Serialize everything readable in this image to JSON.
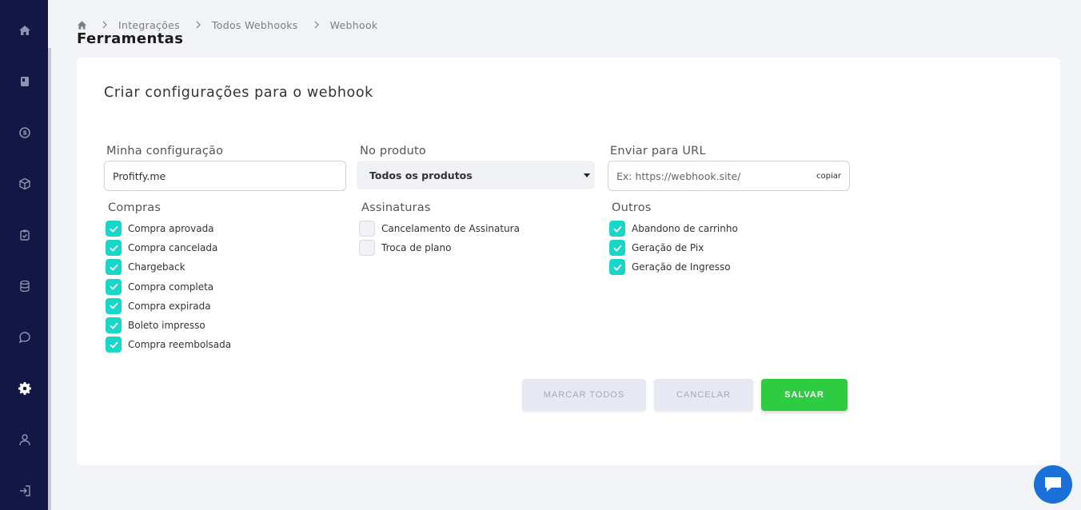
{
  "sidebar": {
    "items": [
      {
        "icon": "home-icon"
      },
      {
        "icon": "book-icon"
      },
      {
        "icon": "dollar-icon"
      },
      {
        "icon": "box-icon"
      },
      {
        "icon": "clipboard-check-icon"
      },
      {
        "icon": "database-icon"
      },
      {
        "icon": "chat-icon"
      },
      {
        "icon": "gear-icon",
        "active": true
      },
      {
        "icon": "user-icon"
      },
      {
        "icon": "logout-icon"
      }
    ]
  },
  "breadcrumb": [
    "Integrações",
    "Todos Webhooks",
    "Webhook"
  ],
  "page_title": "Ferramentas",
  "card": {
    "title": "Criar configurações para o webhook",
    "config": {
      "label": "Minha configuração",
      "value": "Profitfy.me"
    },
    "product": {
      "label": "No produto",
      "value": "Todos os produtos"
    },
    "url": {
      "label": "Enviar para URL",
      "placeholder": "Ex: https://webhook.site/",
      "copy_label": "copiar"
    },
    "groups": [
      {
        "label": "Compras",
        "items": [
          {
            "label": "Compra aprovada",
            "checked": true
          },
          {
            "label": "Compra cancelada",
            "checked": true
          },
          {
            "label": "Chargeback",
            "checked": true
          },
          {
            "label": "Compra completa",
            "checked": true
          },
          {
            "label": "Compra expirada",
            "checked": true
          },
          {
            "label": "Boleto impresso",
            "checked": true
          },
          {
            "label": "Compra reembolsada",
            "checked": true
          }
        ]
      },
      {
        "label": "Assinaturas",
        "items": [
          {
            "label": "Cancelamento de Assinatura",
            "checked": false
          },
          {
            "label": "Troca de plano",
            "checked": false
          }
        ]
      },
      {
        "label": "Outros",
        "items": [
          {
            "label": "Abandono de carrinho",
            "checked": true
          },
          {
            "label": "Geração de Pix",
            "checked": true
          },
          {
            "label": "Geração de Ingresso",
            "checked": true
          }
        ]
      }
    ],
    "buttons": {
      "select_all": "MARCAR TODOS",
      "cancel": "CANCELAR",
      "save": "SALVAR"
    }
  },
  "colors": {
    "sidebar": "#131745",
    "checkbox_on": "#18d6c8",
    "save_button": "#2ecc40",
    "chat_fab": "#1a6fd8"
  }
}
